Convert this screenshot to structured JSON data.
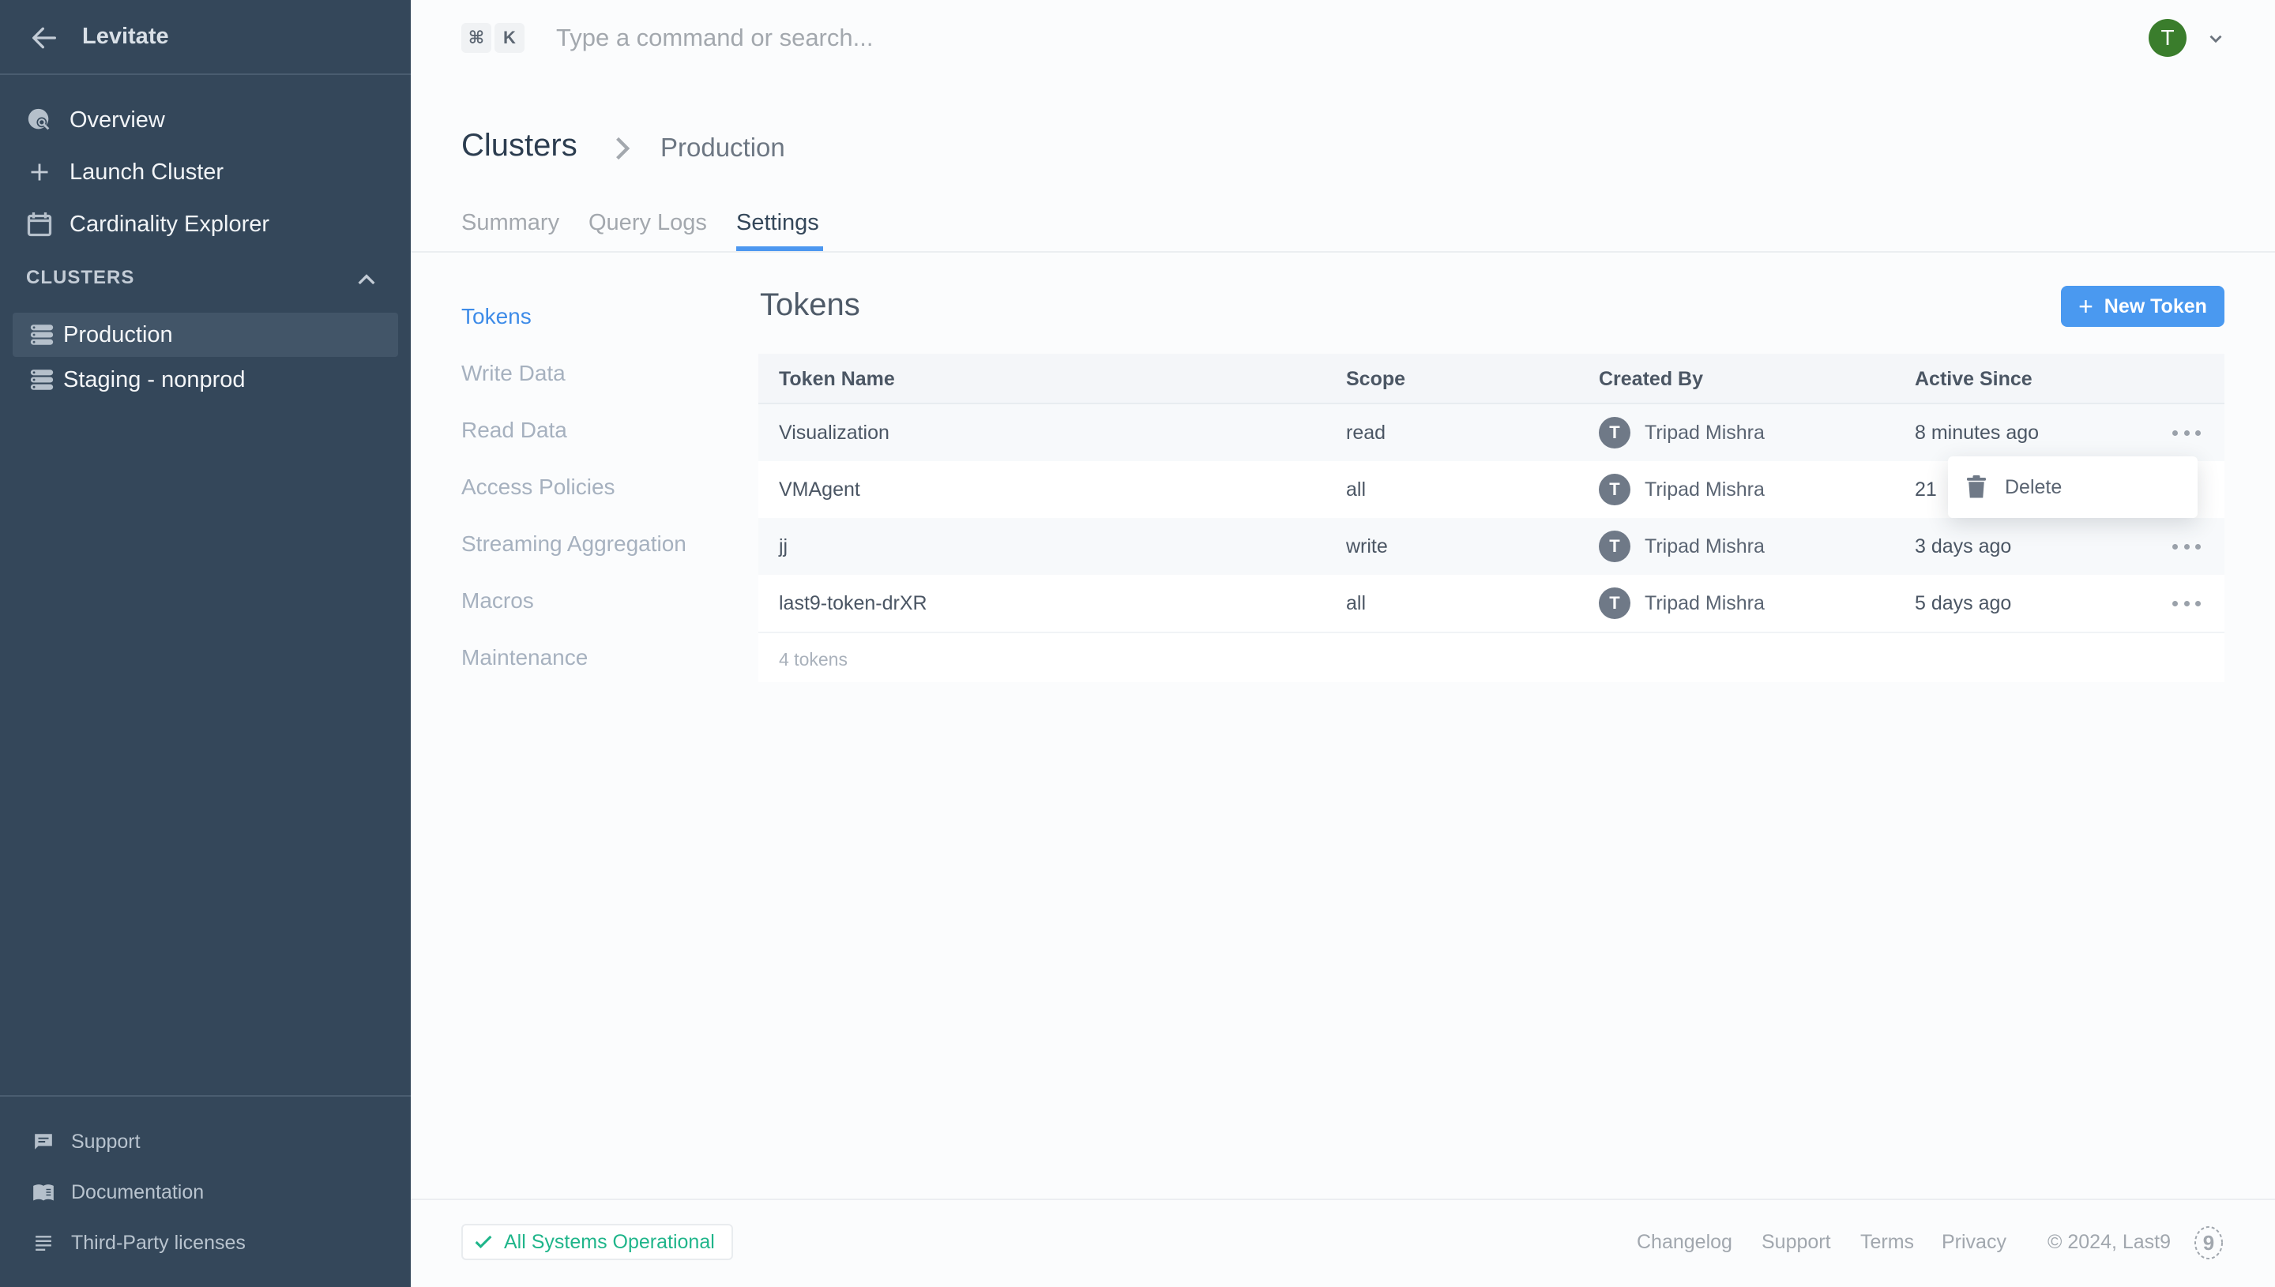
{
  "sidebar": {
    "brand": "Levitate",
    "nav": [
      {
        "label": "Overview",
        "icon": "globe-search-icon"
      },
      {
        "label": "Launch Cluster",
        "icon": "plus-icon"
      },
      {
        "label": "Cardinality Explorer",
        "icon": "calendar-icon"
      }
    ],
    "section_title": "CLUSTERS",
    "clusters": [
      {
        "label": "Production",
        "active": true
      },
      {
        "label": "Staging - nonprod",
        "active": false
      }
    ],
    "footer": [
      {
        "label": "Support",
        "icon": "chat-icon"
      },
      {
        "label": "Documentation",
        "icon": "book-icon"
      },
      {
        "label": "Third-Party licenses",
        "icon": "lines-icon"
      }
    ]
  },
  "topbar": {
    "shortcut_keys": [
      "⌘",
      "K"
    ],
    "search_placeholder": "Type a command or search...",
    "avatar_initial": "T"
  },
  "breadcrumb": {
    "root": "Clusters",
    "current": "Production"
  },
  "tabs": [
    {
      "label": "Summary",
      "active": false
    },
    {
      "label": "Query Logs",
      "active": false
    },
    {
      "label": "Settings",
      "active": true
    }
  ],
  "settings_nav": [
    {
      "label": "Tokens",
      "active": true
    },
    {
      "label": "Write Data",
      "active": false
    },
    {
      "label": "Read Data",
      "active": false
    },
    {
      "label": "Access Policies",
      "active": false
    },
    {
      "label": "Streaming Aggregation",
      "active": false
    },
    {
      "label": "Macros",
      "active": false
    },
    {
      "label": "Maintenance",
      "active": false
    }
  ],
  "tokens": {
    "title": "Tokens",
    "new_button": "New Token",
    "columns": [
      "Token Name",
      "Scope",
      "Created By",
      "Active Since"
    ],
    "rows": [
      {
        "name": "Visualization",
        "scope": "read",
        "creator_initial": "T",
        "creator": "Tripad Mishra",
        "active_since": "8 minutes ago"
      },
      {
        "name": "VMAgent",
        "scope": "all",
        "creator_initial": "T",
        "creator": "Tripad Mishra",
        "active_since": "21"
      },
      {
        "name": "jj",
        "scope": "write",
        "creator_initial": "T",
        "creator": "Tripad Mishra",
        "active_since": "3 days ago"
      },
      {
        "name": "last9-token-drXR",
        "scope": "all",
        "creator_initial": "T",
        "creator": "Tripad Mishra",
        "active_since": "5 days ago"
      }
    ],
    "count_label": "4 tokens",
    "row_menu": {
      "items": [
        "Delete"
      ]
    }
  },
  "footer": {
    "status": "All Systems Operational",
    "links": [
      "Changelog",
      "Support",
      "Terms",
      "Privacy"
    ],
    "copyright": "© 2024, Last9",
    "logo_glyph": "9"
  },
  "colors": {
    "sidebar_bg": "#34475a",
    "accent": "#4a99f0",
    "status_green": "#1fb58a",
    "avatar_green": "#3a7d2c"
  }
}
